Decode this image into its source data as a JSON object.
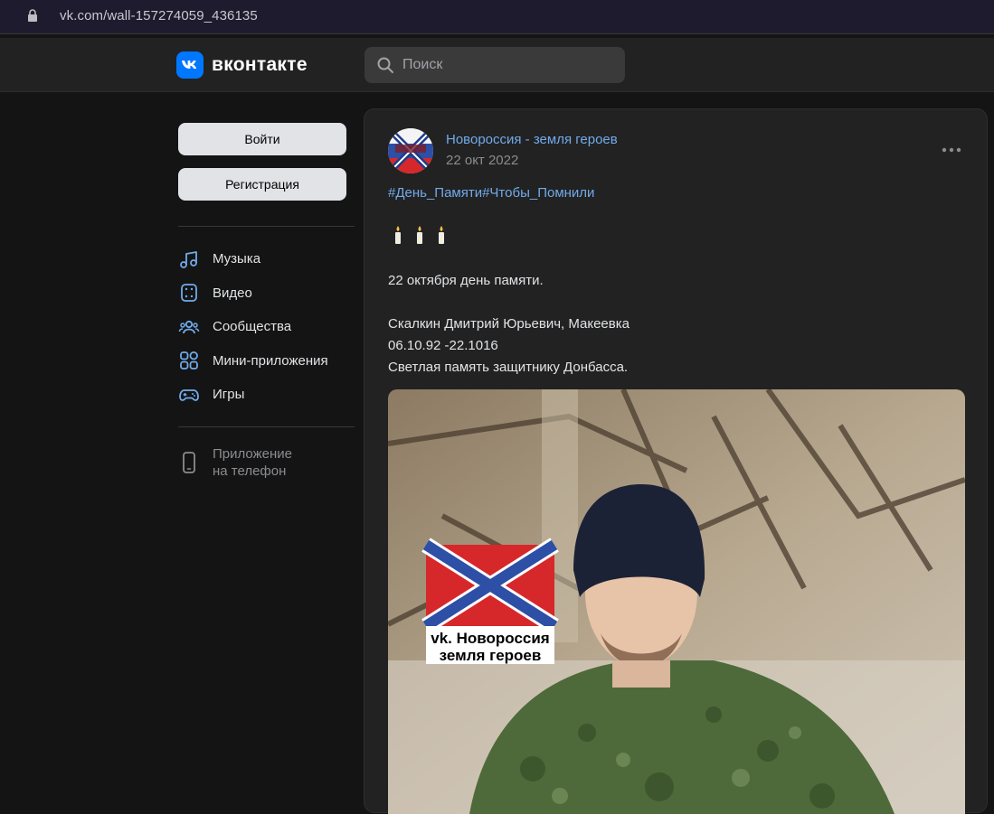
{
  "browser": {
    "url": "vk.com/wall-157274059_436135"
  },
  "header": {
    "logo_text": "вконтакте",
    "search_placeholder": "Поиск"
  },
  "sidebar": {
    "login_label": "Войти",
    "register_label": "Регистрация",
    "items": [
      {
        "label": "Музыка",
        "icon": "music-icon"
      },
      {
        "label": "Видео",
        "icon": "video-icon"
      },
      {
        "label": "Сообщества",
        "icon": "communities-icon"
      },
      {
        "label": "Мини-приложения",
        "icon": "mini-apps-icon"
      },
      {
        "label": "Игры",
        "icon": "games-icon"
      }
    ],
    "app_line1": "Приложение",
    "app_line2": "на телефон"
  },
  "post": {
    "author": "Новороссия - земля героев",
    "date": "22 окт 2022",
    "hashtags": "#День_Памяти#Чтобы_Помнили",
    "candles": "🕯🕯🕯",
    "line1": "22 октября день памяти.",
    "line2": "Скалкин Дмитрий Юрьевич, Макеевка",
    "line3": "06.10.92 -22.1016",
    "line4": "Светлая память защитнику Донбасса.",
    "photo_caption_line1": "vk. Новороссия",
    "photo_caption_line2": "земля героев"
  },
  "colors": {
    "accent": "#71aaeb",
    "brand": "#0077ff",
    "background": "#141414",
    "card": "#222222"
  }
}
